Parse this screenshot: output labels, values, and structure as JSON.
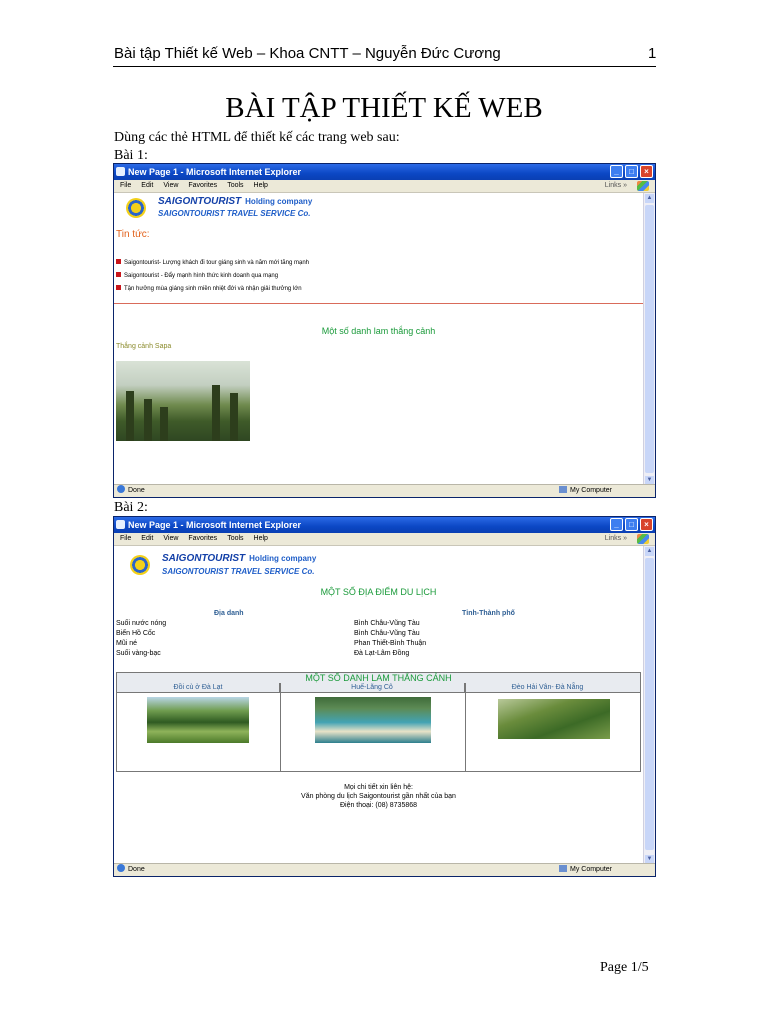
{
  "page": {
    "header_text": "Bài tập Thiết kế Web – Khoa CNTT – Nguyễn Đức Cương",
    "page_number": "1",
    "doc_title": "BÀI TẬP THIẾT KẾ WEB",
    "intro": "Dùng các thẻ HTML để thiết kế các trang web sau:",
    "bai1_label": "Bài 1:",
    "bai2_label": "Bài 2:",
    "footer": "Page 1/5"
  },
  "window": {
    "title": "New Page 1 - Microsoft Internet Explorer",
    "menu": [
      "File",
      "Edit",
      "View",
      "Favorites",
      "Tools",
      "Help"
    ],
    "links_label": "Links",
    "links_chevron": "»",
    "status_left": "Done",
    "status_right": "My Computer",
    "btn_min": "_",
    "btn_max": "□",
    "btn_close": "×",
    "scroll_up": "▲",
    "scroll_down": "▼"
  },
  "brand": {
    "line1": "SAIGONTOURIST",
    "line1_sub": "Holding company",
    "line2": "SAIGONTOURIST TRAVEL SERVICE Co."
  },
  "bai1": {
    "news_title": "Tin tức:",
    "news_items": [
      "Saigontourist- Lượng khách đi tour giáng sinh và năm mới tăng mạnh",
      "Saigontourist - Đẩy mạnh hình thức kinh doanh qua mạng",
      "Tận hưởng mùa giáng sinh miền nhiệt đới và nhận giải thưởng lớn"
    ],
    "section_title": "Một số danh lam thắng cảnh",
    "sapa_label": "Thắng cảnh Sapa"
  },
  "bai2": {
    "section_title": "MỘT SỐ ĐỊA ĐIỂM DU LỊCH",
    "col1_header": "Địa danh",
    "col2_header": "Tỉnh-Thành phố",
    "places": [
      {
        "name": "Suối nước nóng",
        "province": "Bình Châu-Vũng Tàu"
      },
      {
        "name": "Biển Hồ Cốc",
        "province": "Bình Châu-Vũng Tàu"
      },
      {
        "name": "Mũi né",
        "province": "Phan Thiết-Bình Thuận"
      },
      {
        "name": "Suối vàng-bạc",
        "province": "Đà Lạt-Lâm Đồng"
      }
    ],
    "table_title": "MỘT SỐ DANH LAM THẮNG CẢNH",
    "table_cols": [
      "Đồi cù ở Đà Lạt",
      "Huế-Lăng Cô",
      "Đèo Hải Vân- Đà Nẵng"
    ],
    "contact": [
      "Mọi chi tiết xin liên hệ:",
      "Văn phòng du lịch Saigontourist gần nhất của bạn",
      "Điện thoại: (08) 8735868"
    ]
  }
}
